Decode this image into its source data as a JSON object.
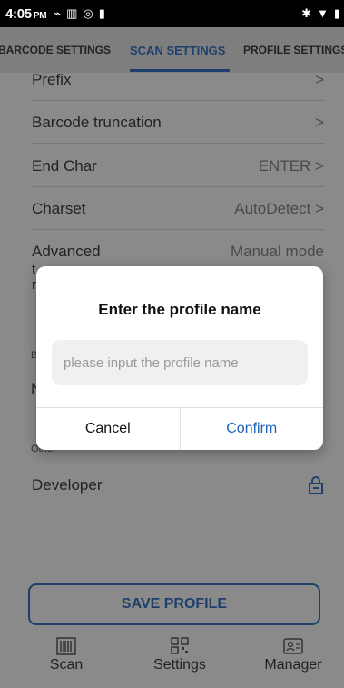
{
  "status_bar": {
    "time": "4:05",
    "ampm": "PM"
  },
  "tabs": [
    {
      "label": "BARCODE SETTINGS"
    },
    {
      "label": "SCAN SETTINGS"
    },
    {
      "label": "PROFILE SETTINGS"
    }
  ],
  "settings": {
    "prefix": {
      "label": "Prefix",
      "value": ">"
    },
    "truncation": {
      "label": "Barcode truncation",
      "value": ">"
    },
    "end_char": {
      "label": "End Char",
      "value": "ENTER >"
    },
    "charset": {
      "label": "Charset",
      "value": "AutoDetect >"
    },
    "advanced": {
      "label": "Advanced",
      "label_line2": "t",
      "label_line3": "r",
      "value": "Manual mode"
    },
    "section_b": "B",
    "row_m": "N",
    "other_section": "Other",
    "developer": {
      "label": "Developer"
    }
  },
  "dialog": {
    "title": "Enter the profile name",
    "input_placeholder": "please input the profile name",
    "cancel": "Cancel",
    "confirm": "Confirm"
  },
  "save_button": "SAVE PROFILE",
  "bottom_nav": [
    {
      "label": "Scan",
      "icon": "barcode-icon"
    },
    {
      "label": "Settings",
      "icon": "qr-code-icon"
    },
    {
      "label": "Manager",
      "icon": "profile-card-icon"
    }
  ]
}
